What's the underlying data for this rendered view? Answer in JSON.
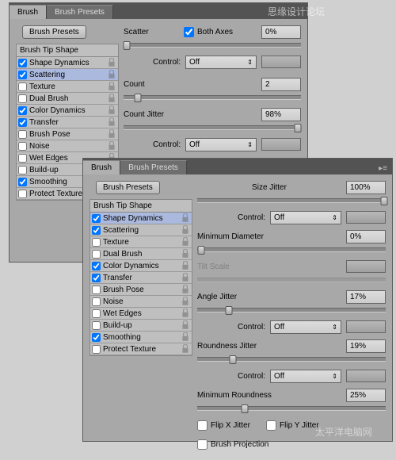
{
  "tabs": {
    "brush": "Brush",
    "presets": "Brush Presets"
  },
  "buttons": {
    "presets": "Brush Presets"
  },
  "sections": {
    "tipShape": "Brush Tip Shape"
  },
  "sidebar": {
    "items": [
      {
        "label": "Shape Dynamics",
        "checked": true
      },
      {
        "label": "Scattering",
        "checked": true
      },
      {
        "label": "Texture",
        "checked": false
      },
      {
        "label": "Dual Brush",
        "checked": false
      },
      {
        "label": "Color Dynamics",
        "checked": true
      },
      {
        "label": "Transfer",
        "checked": true
      },
      {
        "label": "Brush Pose",
        "checked": false
      },
      {
        "label": "Noise",
        "checked": false
      },
      {
        "label": "Wet Edges",
        "checked": false
      },
      {
        "label": "Build-up",
        "checked": false
      },
      {
        "label": "Smoothing",
        "checked": true
      },
      {
        "label": "Protect Texture",
        "checked": false
      }
    ]
  },
  "panel1": {
    "scatter": {
      "label": "Scatter",
      "bothAxes": "Both Axes",
      "bothAxesChecked": true,
      "value": "0%"
    },
    "controlLabel": "Control:",
    "control1": "Off",
    "count": {
      "label": "Count",
      "value": "2"
    },
    "countJitter": {
      "label": "Count Jitter",
      "value": "98%"
    },
    "control2": "Off"
  },
  "panel2": {
    "sizeJitter": {
      "label": "Size Jitter",
      "value": "100%"
    },
    "control1": "Off",
    "minDiameter": {
      "label": "Minimum Diameter",
      "value": "0%"
    },
    "tiltScale": {
      "label": "Tilt Scale"
    },
    "angleJitter": {
      "label": "Angle Jitter",
      "value": "17%"
    },
    "control2": "Off",
    "roundnessJitter": {
      "label": "Roundness Jitter",
      "value": "19%"
    },
    "control3": "Off",
    "minRoundness": {
      "label": "Minimum Roundness",
      "value": "25%"
    },
    "flipX": "Flip X Jitter",
    "flipY": "Flip Y Jitter",
    "brushProj": "Brush Projection",
    "controlLabel": "Control:"
  },
  "watermarks": {
    "top": "思缘设计论坛",
    "bottom": "太平洋电脑网"
  }
}
